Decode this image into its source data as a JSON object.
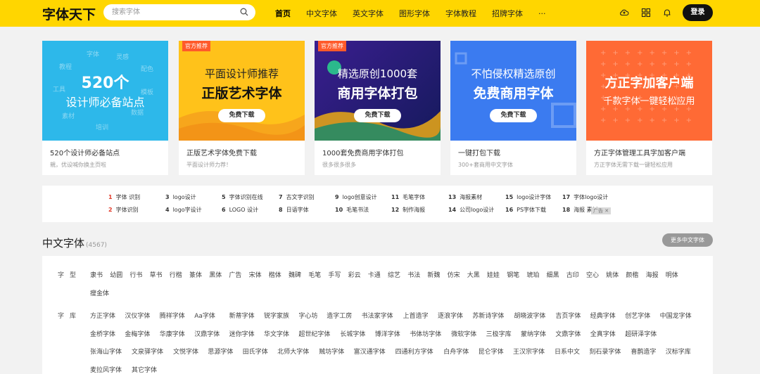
{
  "header": {
    "logo": "字体天下",
    "search_placeholder": "搜索字体",
    "nav": [
      "首页",
      "中文字体",
      "英文字体",
      "图形字体",
      "字体教程",
      "招牌字体",
      "···"
    ],
    "login": "登录",
    "icons": [
      "cloud-upload-icon",
      "grid-icon",
      "bell-icon"
    ],
    "accent_color": "#ffd600"
  },
  "cards": [
    {
      "badge": "",
      "line1": "520个",
      "line2": "设计师必备站点",
      "button": "",
      "title": "520个设计师必备站点",
      "sub": "親，优设喊你换主页啦",
      "bg": "#2db8ea",
      "words": [
        "字体",
        "教程",
        "灵感",
        "工具",
        "配色",
        "素材",
        "模板",
        "培训",
        "数据"
      ]
    },
    {
      "badge": "官方推荐",
      "line1": "平面设计师推荐",
      "line2": "正版艺术字体",
      "button": "免费下载",
      "title": "正版艺术字体免费下载",
      "sub": "平面设计师力荐！",
      "bg": "#ffc21a"
    },
    {
      "badge": "官方推荐",
      "line1": "精选原创1000套",
      "line2": "商用字体打包",
      "button": "免费下载",
      "title": "1000套免费商用字体打包",
      "sub": "很多很多很多",
      "bg": "#2a1f7a"
    },
    {
      "badge": "",
      "line1": "不怕侵权精选原创",
      "line2": "免费商用字体",
      "button": "免费下载",
      "title": "一键打包下载",
      "sub": "300+套商用中文字体",
      "bg": "#3b7bf0"
    },
    {
      "badge": "",
      "line1": "方正字加客户端",
      "line2": "千款字体一键轻松应用",
      "button": "",
      "title": "方正字体管理工具字加客户端",
      "sub": "方正字体无需下载一键轻松应用",
      "bg": "#ff6a35"
    }
  ],
  "hot_keywords": [
    {
      "num": "1",
      "text": "字体 识别"
    },
    {
      "num": "2",
      "text": "字体识别"
    },
    {
      "num": "3",
      "text": "logo设计"
    },
    {
      "num": "4",
      "text": "logo字设计"
    },
    {
      "num": "5",
      "text": "字体识别在线"
    },
    {
      "num": "6",
      "text": "LOGO 设计"
    },
    {
      "num": "7",
      "text": "古文字识别"
    },
    {
      "num": "8",
      "text": "日语字体"
    },
    {
      "num": "9",
      "text": "logo创意设计"
    },
    {
      "num": "10",
      "text": "毛笔书法"
    },
    {
      "num": "11",
      "text": "毛笔字体"
    },
    {
      "num": "12",
      "text": "制作海报"
    },
    {
      "num": "13",
      "text": "海报素材"
    },
    {
      "num": "14",
      "text": "公司logo设计"
    },
    {
      "num": "15",
      "text": "logo设计字体"
    },
    {
      "num": "16",
      "text": "PS字体下载"
    },
    {
      "num": "17",
      "text": "字体logo设计"
    },
    {
      "num": "18",
      "text": "海报 素材"
    }
  ],
  "ad_label": "广告",
  "section": {
    "title": "中文字体",
    "count": "(4567)",
    "more": "更多中文字体",
    "row1_label": "字型",
    "row1": [
      "隶书",
      "幼圆",
      "行书",
      "草书",
      "行楷",
      "篆体",
      "黑体",
      "广告",
      "宋体",
      "楷体",
      "魏碑",
      "毛笔",
      "手写",
      "彩云",
      "卡通",
      "综艺",
      "书法",
      "新魏",
      "仿宋",
      "大黑",
      "娃娃",
      "钢笔",
      "琥珀",
      "细黑",
      "古印",
      "空心",
      "姚体",
      "颜楷",
      "海报",
      "明体",
      "瘦金体"
    ],
    "row2_label": "字库",
    "row2": [
      "方正字体",
      "汉仪字体",
      "腾祥字体",
      "Aa字体",
      "新蒂字体",
      "锐字家族",
      "字心坊",
      "造字工房",
      "书法家字体",
      "上首造字",
      "逐浪字体",
      "苏新诗字体",
      "胡晓波字体",
      "吉页字体",
      "经典字体",
      "创艺字体",
      "中国龙字体",
      "金桥字体",
      "金梅字体",
      "华康字体",
      "汉鼎字体",
      "迷你字体",
      "华文字体",
      "超世纪字体",
      "长城字体",
      "博洋字体",
      "书体坊字体",
      "微软字体",
      "三极字库",
      "蒙纳字体",
      "文鼎字体",
      "全真字体",
      "超研泽字体",
      "张海山字体",
      "文泉驿字体",
      "文悦字体",
      "思源字体",
      "田氏字体",
      "北师大字体",
      "贼坊字体",
      "富汉通字体",
      "四通利方字体",
      "白舟字体",
      "昆仑字体",
      "王汉宗字体",
      "日系中文",
      "刻石录字体",
      "喜鹊造字",
      "汉标字库",
      "麦拉风字体",
      "其它字体"
    ]
  }
}
